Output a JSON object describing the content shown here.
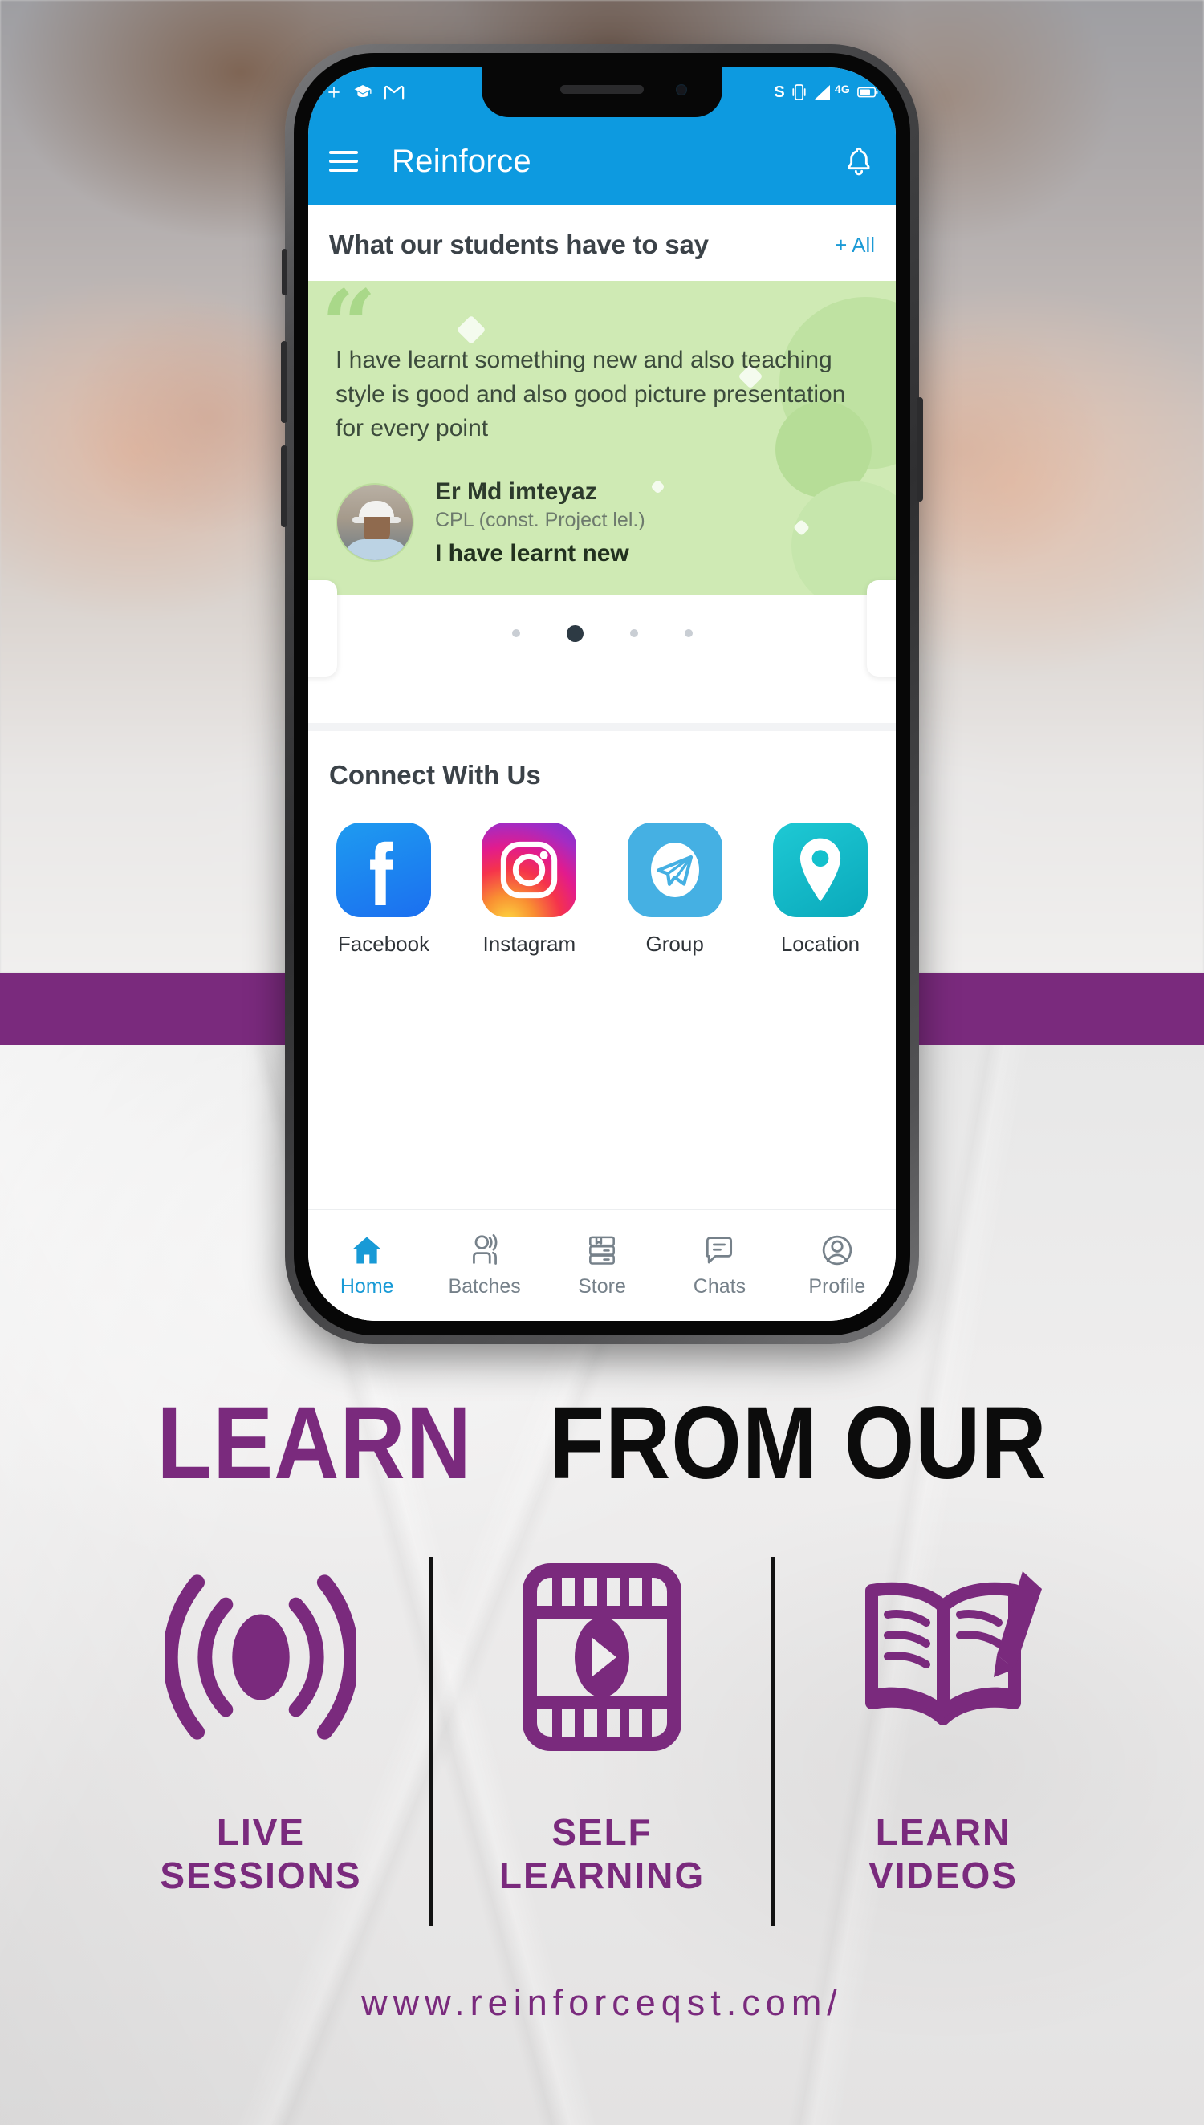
{
  "phone": {
    "status_bar": {
      "left_icons": [
        "plus-icon",
        "graduation-cap-icon",
        "gmail-icon"
      ],
      "right_icons": [
        "sync-icon",
        "vibrate-icon",
        "signal-4g-icon",
        "battery-icon"
      ],
      "network_label": "4G",
      "signal_label": "S"
    },
    "app_bar": {
      "menu_icon": "hamburger-menu-icon",
      "title": "Reinforce",
      "bell_icon": "notification-bell-icon"
    },
    "testimonials": {
      "section_title": "What our students have to say",
      "view_all_label": "+ All",
      "quote": "I have learnt something new and also teaching style is good and also good picture presentation for every point",
      "author_name": "Er Md imteyaz",
      "author_role": "CPL (const. Project lel.)",
      "author_sub": "I have learnt new",
      "carousel": {
        "total": 4,
        "active_index": 1
      }
    },
    "connect": {
      "title": "Connect With Us",
      "items": [
        {
          "label": "Facebook",
          "icon": "facebook-icon",
          "color": "#1877f2"
        },
        {
          "label": "Instagram",
          "icon": "instagram-icon",
          "color": "#e1306c"
        },
        {
          "label": "Group",
          "icon": "telegram-icon",
          "color": "#45b0e3"
        },
        {
          "label": "Location",
          "icon": "map-pin-icon",
          "color": "#12bdca"
        }
      ]
    },
    "bottom_nav": {
      "active_index": 0,
      "items": [
        {
          "label": "Home",
          "icon": "home-icon"
        },
        {
          "label": "Batches",
          "icon": "person-speaking-icon"
        },
        {
          "label": "Store",
          "icon": "books-stack-icon"
        },
        {
          "label": "Chats",
          "icon": "chat-bubble-icon"
        },
        {
          "label": "Profile",
          "icon": "profile-avatar-icon"
        }
      ]
    }
  },
  "promo": {
    "headline_part1": "LEARN",
    "headline_part2": "FROM OUR",
    "headline_color_1": "#7a2a7d",
    "headline_color_2": "#0c0c0c",
    "features": [
      {
        "icon": "live-broadcast-icon",
        "line1": "LIVE",
        "line2": "SESSIONS"
      },
      {
        "icon": "film-play-icon",
        "line1": "SELF",
        "line2": "LEARNING"
      },
      {
        "icon": "book-pencil-icon",
        "line1": "LEARN",
        "line2": "VIDEOS"
      }
    ],
    "accent_color": "#7a2a7d",
    "website": "www.reinforceqst.com/"
  }
}
